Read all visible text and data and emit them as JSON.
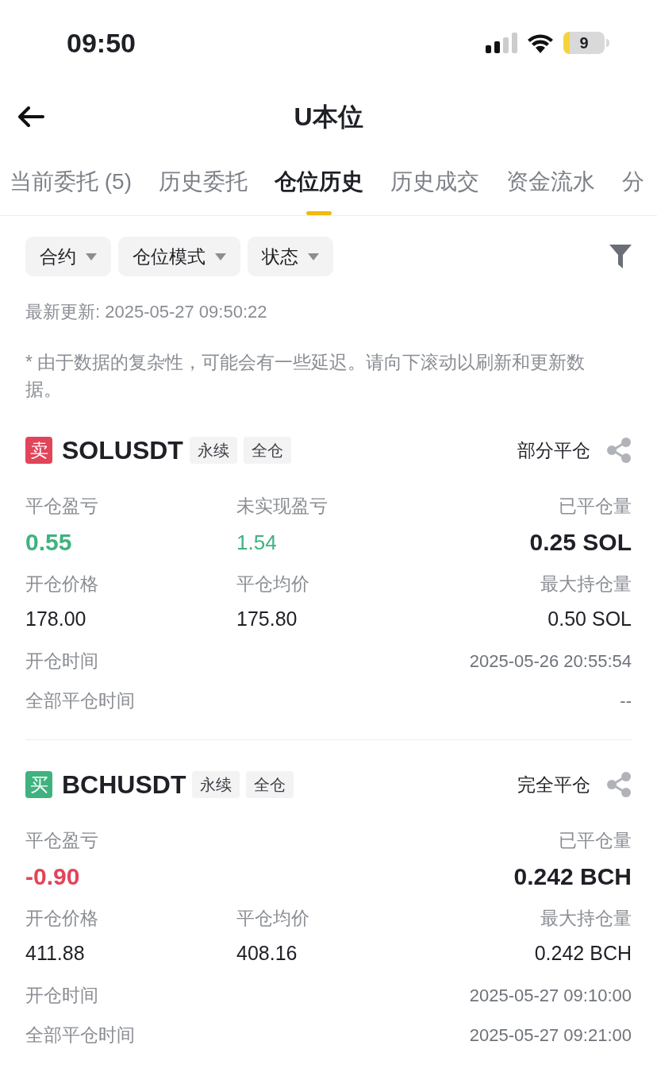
{
  "status_bar": {
    "time": "09:50",
    "battery": "9"
  },
  "header": {
    "title": "U本位"
  },
  "tabs": [
    {
      "label": "当前委托 (5)",
      "selected": false
    },
    {
      "label": "历史委托",
      "selected": false
    },
    {
      "label": "仓位历史",
      "selected": true
    },
    {
      "label": "历史成交",
      "selected": false
    },
    {
      "label": "资金流水",
      "selected": false
    },
    {
      "label": "分",
      "selected": false
    }
  ],
  "filters": [
    "合约",
    "仓位模式",
    "状态"
  ],
  "updated": "最新更新: 2025-05-27 09:50:22",
  "note": "* 由于数据的复杂性，可能会有一些延迟。请向下滚动以刷新和更新数据。",
  "positions": [
    {
      "kind": "sell",
      "side_label": "卖",
      "symbol": "SOLUSDT",
      "tags": [
        "永续",
        "全仓"
      ],
      "status": "部分平仓",
      "realized": {
        "label": "平仓盈亏",
        "value": "0.55",
        "color": "#3fb27f"
      },
      "unrealized": {
        "label": "未实现盈亏",
        "value": "1.54",
        "color": "#3fb27f"
      },
      "closed_qty": {
        "label": "已平仓量",
        "value": "0.25 SOL"
      },
      "details": [
        {
          "label": "开仓价格",
          "value": "178.00"
        },
        {
          "label": "平仓均价",
          "value": "175.80"
        },
        {
          "label": "最大持仓量",
          "value": "0.50 SOL"
        }
      ],
      "times": [
        {
          "label": "开仓时间",
          "value": "2025-05-26 20:55:54"
        },
        {
          "label": "全部平仓时间",
          "value": "--"
        }
      ]
    },
    {
      "kind": "buy",
      "side_label": "买",
      "symbol": "BCHUSDT",
      "tags": [
        "永续",
        "全仓"
      ],
      "status": "完全平仓",
      "realized": {
        "label": "平仓盈亏",
        "value": "-0.90",
        "color": "#e0455a"
      },
      "closed_qty": {
        "label": "已平仓量",
        "value": "0.242 BCH"
      },
      "details": [
        {
          "label": "开仓价格",
          "value": "411.88"
        },
        {
          "label": "平仓均价",
          "value": "408.16"
        },
        {
          "label": "最大持仓量",
          "value": "0.242 BCH"
        }
      ],
      "times": [
        {
          "label": "开仓时间",
          "value": "2025-05-27 09:10:00"
        },
        {
          "label": "全部平仓时间",
          "value": "2025-05-27 09:21:00"
        }
      ]
    }
  ]
}
